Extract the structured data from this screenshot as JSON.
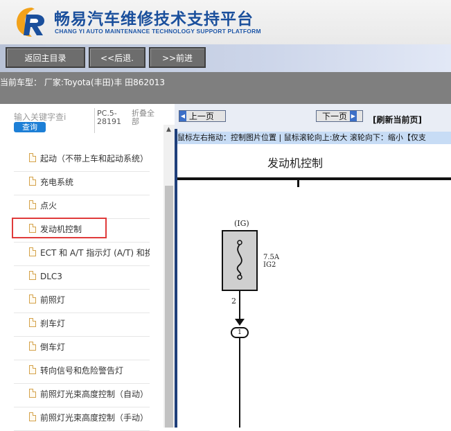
{
  "header": {
    "title": "畅易汽车维修技术支持平台",
    "subtitle": "CHANG YI AUTO MAINTENANCE TECHNOLOGY SUPPORT PLATFORM",
    "logo_icon": "cy-logo-icon"
  },
  "nav": {
    "home_label": "返回主目录",
    "back_label": "<<后退.",
    "forward_label": ">>前进"
  },
  "info": {
    "current_model": "当前车型： 厂家:Toyota(丰田)丰 田862013"
  },
  "sidebar": {
    "search_placeholder": "输入关键字查i",
    "search_button": "查询",
    "pc_info": "PC.5-28191",
    "fold_all": "折叠全部",
    "items": [
      {
        "label": "起动（不带上车和起动系统）"
      },
      {
        "label": "充电系统"
      },
      {
        "label": "点火"
      },
      {
        "label": "发动机控制"
      },
      {
        "label": "ECT 和 A/T 指示灯 (A/T) 和换档"
      },
      {
        "label": "DLC3"
      },
      {
        "label": "前照灯"
      },
      {
        "label": "刹车灯"
      },
      {
        "label": "倒车灯"
      },
      {
        "label": "转向信号和危险警告灯"
      },
      {
        "label": "前照灯光束高度控制（自动）"
      },
      {
        "label": "前照灯光束高度控制（手动）"
      }
    ],
    "selected_index": 3
  },
  "viewer": {
    "prev_label": "上一页",
    "next_label": "下一页",
    "refresh_label": "[刷新当前页]",
    "hint": "鼠标左右拖动：控制图片位置 | 鼠标滚轮向上:放大  滚轮向下：缩小【仅支"
  },
  "diagram": {
    "title": "发动机控制",
    "ig_label": "(IG)",
    "fuse_amp": "7.5A",
    "fuse_name": "IG2",
    "pin_label": "2",
    "connector_label": "1"
  },
  "colors": {
    "brand_blue": "#1a4f9c",
    "selected_outline": "#e03a3a",
    "search_button": "#1d7fd6"
  }
}
